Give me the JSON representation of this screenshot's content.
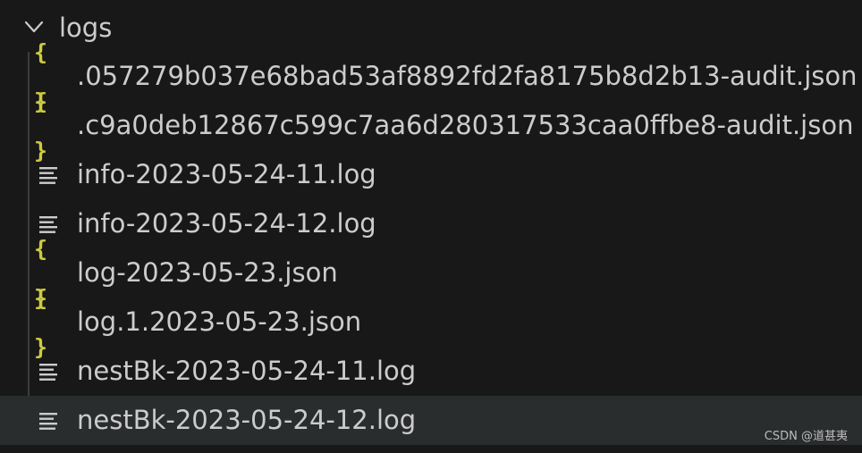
{
  "explorer": {
    "folder": {
      "name": "logs",
      "expanded": true,
      "chevron_icon": "chevron-down-icon"
    },
    "files": [
      {
        "name": ".057279b037e68bad53af8892fd2fa8175b8d2b13-audit.json",
        "icon": "json-braces-icon",
        "icon_glyph": "{ }",
        "icon_color": "#cbcb41",
        "selected": false
      },
      {
        "name": ".c9a0deb12867c599c7aa6d280317533caa0ffbe8-audit.json",
        "icon": "json-braces-icon",
        "icon_glyph": "{ }",
        "icon_color": "#cbcb41",
        "selected": false
      },
      {
        "name": "info-2023-05-24-11.log",
        "icon": "text-lines-icon",
        "selected": false
      },
      {
        "name": "info-2023-05-24-12.log",
        "icon": "text-lines-icon",
        "selected": false
      },
      {
        "name": "log-2023-05-23.json",
        "icon": "json-braces-icon",
        "icon_glyph": "{ }",
        "icon_color": "#cbcb41",
        "selected": false
      },
      {
        "name": "log.1.2023-05-23.json",
        "icon": "json-braces-icon",
        "icon_glyph": "{ }",
        "icon_color": "#cbcb41",
        "selected": false
      },
      {
        "name": "nestBk-2023-05-24-11.log",
        "icon": "text-lines-icon",
        "selected": false
      },
      {
        "name": "nestBk-2023-05-24-12.log",
        "icon": "text-lines-icon",
        "selected": true
      }
    ]
  },
  "watermark": {
    "text": "CSDN @道甚夷"
  },
  "colors": {
    "background": "#181818",
    "text": "#cccccc",
    "json_icon": "#cbcb41",
    "selected_row": "#2a2d2e",
    "indent_guide": "#3d3d3d"
  }
}
